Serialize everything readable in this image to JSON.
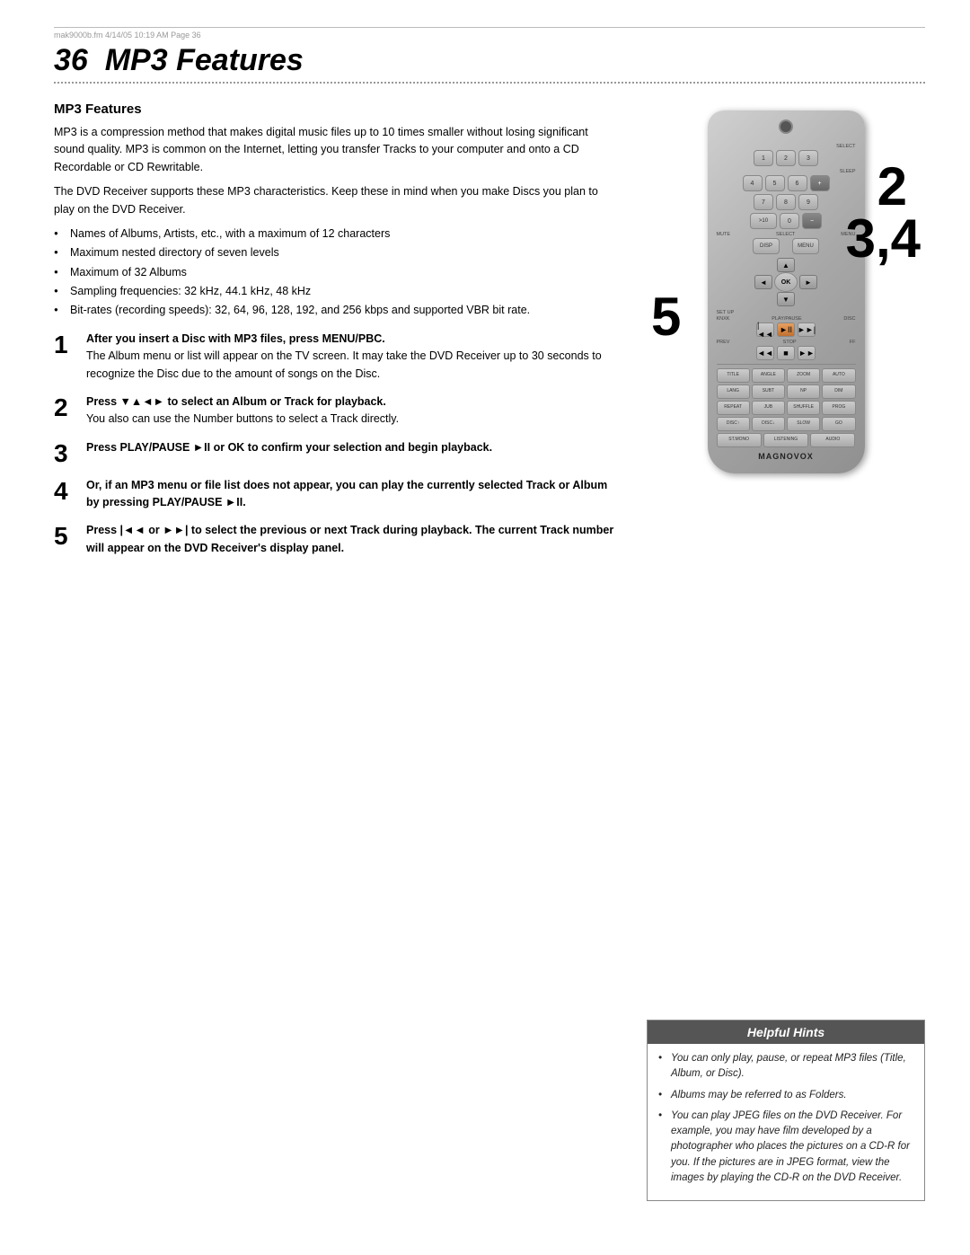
{
  "page": {
    "number": "36",
    "title": "MP3 Features"
  },
  "header_bar": "mak9000b.fm  4/14/05  10:19 AM  Page 36",
  "section": {
    "heading": "MP3 Features",
    "intro_para1": "MP3 is a compression method that makes digital music files up to 10 times smaller without losing significant sound quality. MP3 is common on the Internet, letting you transfer Tracks to your computer and onto a CD Recordable or CD Rewritable.",
    "intro_para2": "The DVD Receiver supports these MP3 characteristics. Keep these in mind when you make Discs you plan to play on the DVD Receiver.",
    "bullet_items": [
      "Names of Albums, Artists, etc., with a maximum of 12 characters",
      "Maximum nested directory of seven levels",
      "Maximum of 32 Albums",
      "Sampling frequencies: 32 kHz, 44.1 kHz, 48 kHz",
      "Bit-rates (recording speeds): 32, 64, 96, 128, 192, and 256 kbps and supported VBR bit rate."
    ],
    "steps": [
      {
        "number": "1",
        "title": "After you insert a Disc with MP3 files, press MENU/PBC.",
        "detail": "The Album menu or list will appear on the TV screen. It may take the DVD Receiver up to 30 seconds to recognize the Disc due to the amount of songs on the Disc."
      },
      {
        "number": "2",
        "title": "Press ▼▲◄► to select an Album or Track for playback.",
        "detail": "You also can use the Number buttons to select a Track directly."
      },
      {
        "number": "3",
        "title": "Press PLAY/PAUSE ►II or OK to confirm your selection and begin playback.",
        "detail": ""
      },
      {
        "number": "4",
        "title": "Or, if an MP3 menu or file list does not appear, you can play the currently selected Track or Album by pressing PLAY/PAUSE ►II.",
        "detail": ""
      },
      {
        "number": "5",
        "title": "Press |◄◄ or ►►| to select the previous or next Track during playback. The current Track number will appear on the DVD Receiver's display panel.",
        "detail": ""
      }
    ]
  },
  "helpful_hints": {
    "title": "Helpful Hints",
    "items": [
      "You can only play, pause, or repeat MP3 files (Title, Album, or Disc).",
      "Albums may be referred to as Folders.",
      "You can play JPEG files on the DVD Receiver. For example, you may have film developed by a photographer who places the pictures on a CD-R for you. If the pictures are in JPEG format, view the images by playing the CD-R on the DVD Receiver."
    ]
  },
  "remote": {
    "brand": "MAGNOVOX"
  },
  "overlay_numbers": {
    "two": "2",
    "three_four": "3,4",
    "five": "5"
  }
}
